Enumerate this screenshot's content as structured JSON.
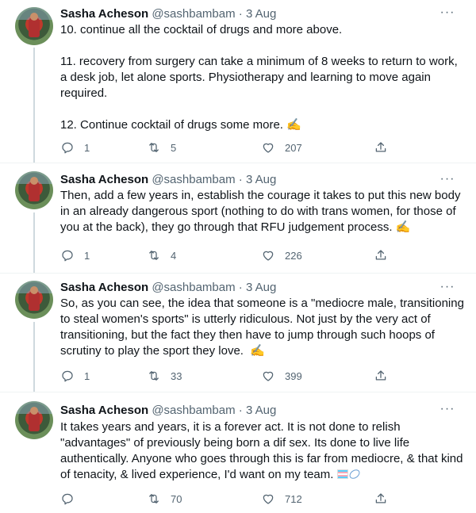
{
  "tweets": [
    {
      "name": "Sasha Acheson",
      "handle": "@sashbambam",
      "separator": "·",
      "date": "3 Aug",
      "more": "···",
      "text": "10. continue all the cocktail of drugs and more above.\n\n11. recovery from surgery can take a minimum of 8 weeks to return to work, a desk job, let alone sports. Physiotherapy and learning to move again required.\n\n12. Continue cocktail of drugs some more. ",
      "emoji": "✍",
      "replies": "1",
      "retweets": "5",
      "likes": "207"
    },
    {
      "name": "Sasha Acheson",
      "handle": "@sashbambam",
      "separator": "·",
      "date": "3 Aug",
      "more": "···",
      "text": "Then, add a few years in, establish the courage it takes to put this new body in an already dangerous sport (nothing to do with trans women, for those of you at the back), they go through that RFU judgement process. ",
      "emoji": "✍",
      "replies": "1",
      "retweets": "4",
      "likes": "226"
    },
    {
      "name": "Sasha Acheson",
      "handle": "@sashbambam",
      "separator": "·",
      "date": "3 Aug",
      "more": "···",
      "text": "So, as you can see, the idea that someone is a \"mediocre male, transitioning to steal women's sports\" is utterly ridiculous. Not just by the very act of transitioning, but the fact they then have to jump through such hoops of scrutiny to play the sport they love.  ",
      "emoji": "✍",
      "replies": "1",
      "retweets": "33",
      "likes": "399"
    },
    {
      "name": "Sasha Acheson",
      "handle": "@sashbambam",
      "separator": "·",
      "date": "3 Aug",
      "more": "···",
      "text": "It takes years and years, it is a forever act. It is not done to relish \"advantages\" of previously being born a dif sex. Its done to live life authentically. Anyone who goes through this is far from mediocre, & that kind of tenacity, & lived experience, I'd want on my team. ",
      "emoji_names": [
        "transgender-flag-icon",
        "rugby-ball-icon"
      ],
      "replies": "",
      "retweets": "70",
      "likes": "712"
    }
  ],
  "icons": [
    "reply-icon",
    "retweet-icon",
    "like-icon",
    "share-icon",
    "more-icon",
    "avatar"
  ],
  "colors": {
    "text": "#0f1419",
    "secondary": "#536471",
    "thread_line": "#cfd9de",
    "separator": "#eff3f4"
  }
}
